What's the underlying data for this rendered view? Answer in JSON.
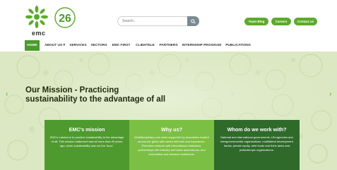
{
  "header": {
    "logo_text": "emc",
    "anniversary": "26",
    "search": {
      "placeholder": "Search..."
    },
    "buttons": {
      "team_blog": "Team Blog",
      "careers": "Careers",
      "contact": "Contact us"
    }
  },
  "nav": {
    "items": [
      "HOME",
      "ABOUT US ▾",
      "SERVICES",
      "SECTORS",
      "EMC FIRST",
      "CLIENTELE",
      "PARTNERS",
      "INTERNSHIP PROGRAM",
      "PUBLICATIONS"
    ],
    "active": "HOME"
  },
  "hero": {
    "headline_line1": "Our Mission - Practicing",
    "headline_line2": "sustainability to the advantage of all",
    "prev_arrow": "‹",
    "next_arrow": "›"
  },
  "cards": [
    {
      "title": "EMC's mission",
      "text": "EMC's mission is to practice sustainability to the advantage of all. This mission statement was all more than 26 years ago, when sustainability was not the 'buzz'.",
      "color": "#4f9a2f"
    },
    {
      "title": "Why us?",
      "text": "Multidisciplinary core team supported by Associates located across the globe with varied skill sets and experience. Extensive network with international institutions, partnerships with industry and trade associations, and universities and research institutions.",
      "color": "#7cbf45"
    },
    {
      "title": "Whom do we work with?",
      "text": "National and international governments, UN agencies and intergovernmental organizations, multilateral development banks, private equity, debt funds and think tanks and philanthropic organizations.",
      "color": "#2f6a2a"
    }
  ],
  "colors": {
    "brand_green": "#5bab2a",
    "nav_active": "#4a9b2e",
    "hero_bg": "#dbe8c3"
  }
}
